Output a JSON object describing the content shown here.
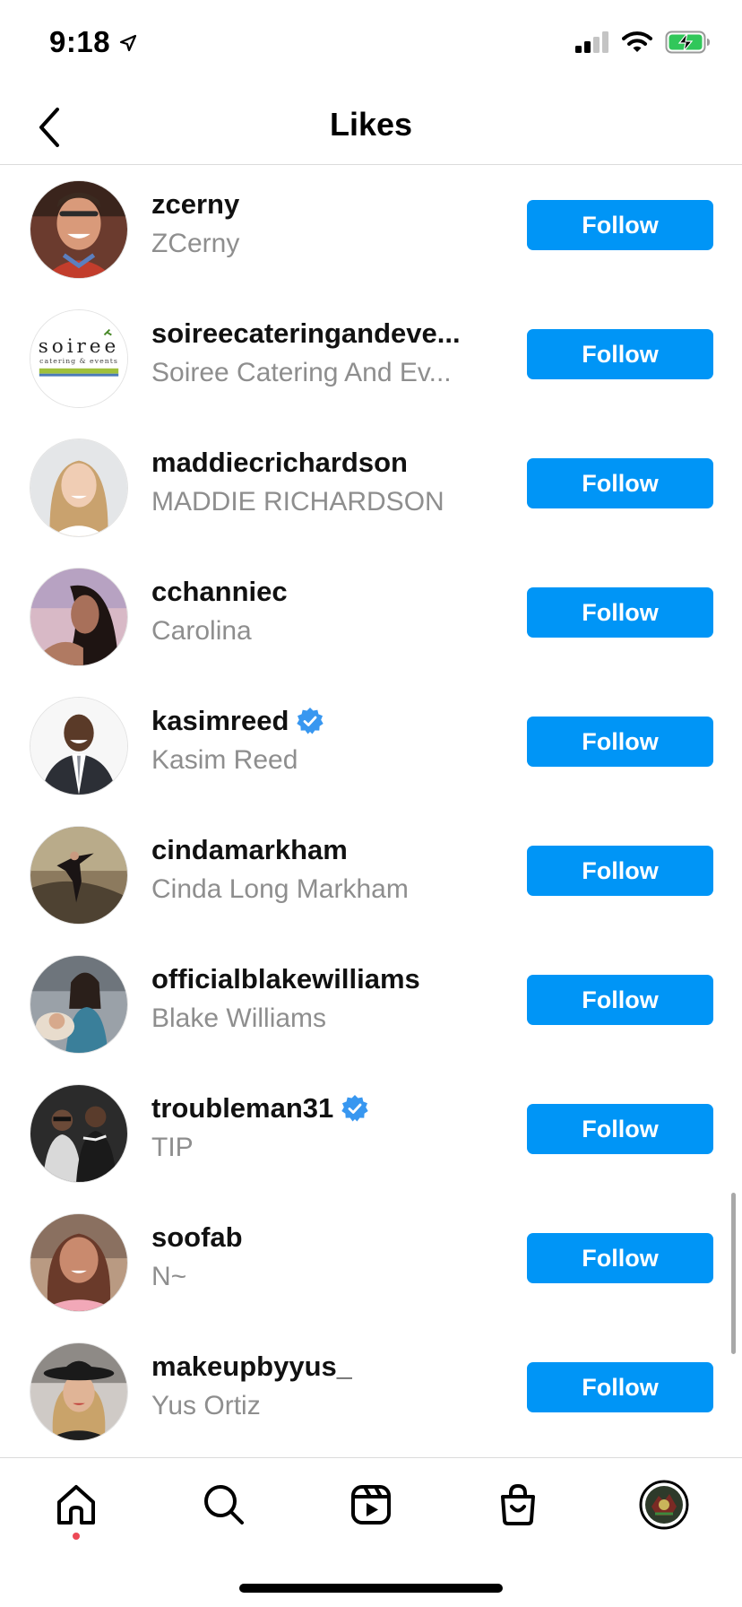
{
  "status_bar": {
    "time": "9:18",
    "icons": [
      "location-arrow-icon",
      "cellular-signal-icon",
      "wifi-icon",
      "battery-charging-icon"
    ]
  },
  "header": {
    "title": "Likes",
    "back_icon": "chevron-left-icon"
  },
  "colors": {
    "accent": "#0095f6",
    "secondary_text": "#8e8e8e",
    "verified": "#3897f0",
    "notification_dot": "#ed4956"
  },
  "users": [
    {
      "username": "zcerny",
      "full_name": "ZCerny",
      "verified": false,
      "button": "Follow"
    },
    {
      "username": "soireecateringandeve...",
      "full_name": "Soiree Catering And Ev...",
      "verified": false,
      "button": "Follow"
    },
    {
      "username": "maddiecrichardson",
      "full_name": "MADDIE RICHARDSON",
      "verified": false,
      "button": "Follow"
    },
    {
      "username": "cchanniec",
      "full_name": "Carolina",
      "verified": false,
      "button": "Follow"
    },
    {
      "username": "kasimreed",
      "full_name": "Kasim Reed",
      "verified": true,
      "button": "Follow"
    },
    {
      "username": "cindamarkham",
      "full_name": "Cinda Long Markham",
      "verified": false,
      "button": "Follow"
    },
    {
      "username": "officialblakewilliams",
      "full_name": "Blake Williams",
      "verified": false,
      "button": "Follow"
    },
    {
      "username": "troubleman31",
      "full_name": "TIP",
      "verified": true,
      "button": "Follow"
    },
    {
      "username": "soofab",
      "full_name": "N~",
      "verified": false,
      "button": "Follow"
    },
    {
      "username": "makeupbyyus_",
      "full_name": "Yus Ortiz",
      "verified": false,
      "button": "Follow"
    }
  ],
  "soiree_logo": {
    "name": "soiree",
    "tagline": "catering & events"
  },
  "tab_bar": {
    "tabs": [
      "home-icon",
      "search-icon",
      "reels-icon",
      "shop-icon",
      "profile-avatar"
    ],
    "active": "home-icon"
  }
}
